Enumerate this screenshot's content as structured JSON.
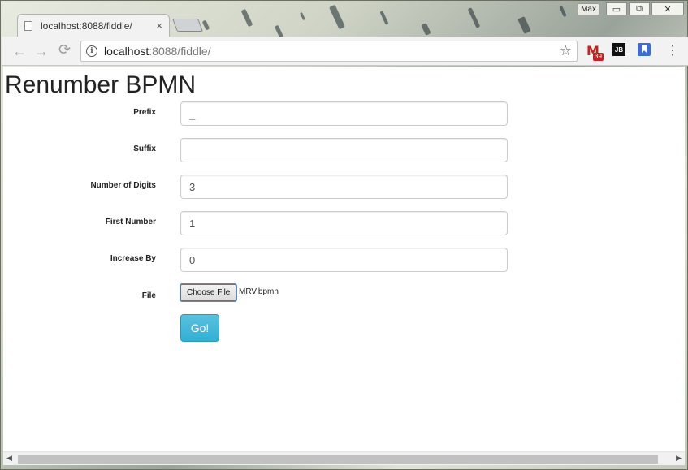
{
  "window": {
    "max_label": "Max",
    "minimize_glyph": "▭",
    "restore_glyph": "⧉",
    "close_glyph": "✕"
  },
  "tab": {
    "title": "localhost:8088/fiddle/",
    "close_glyph": "×"
  },
  "toolbar": {
    "back_glyph": "←",
    "forward_glyph": "→",
    "reload_glyph": "⟳",
    "info_glyph": "i",
    "url_host": "localhost",
    "url_rest": ":8088/fiddle/",
    "star_glyph": "☆",
    "gmail_glyph": "M",
    "gmail_count": "39",
    "jb_label": "JB",
    "menu_glyph": "⋮"
  },
  "page": {
    "title": "Renumber BPMN",
    "fields": {
      "prefix": {
        "label": "Prefix",
        "value": "_"
      },
      "suffix": {
        "label": "Suffix",
        "value": ""
      },
      "digits": {
        "label": "Number of Digits",
        "value": "3"
      },
      "first": {
        "label": "First Number",
        "value": "1"
      },
      "increase": {
        "label": "Increase By",
        "value": "0"
      }
    },
    "file": {
      "label": "File",
      "button_label": "Choose File",
      "file_name": "MRV.bpmn"
    },
    "submit_label": "Go!"
  },
  "scrollbar": {
    "left_arrow": "◀",
    "right_arrow": "▶"
  }
}
